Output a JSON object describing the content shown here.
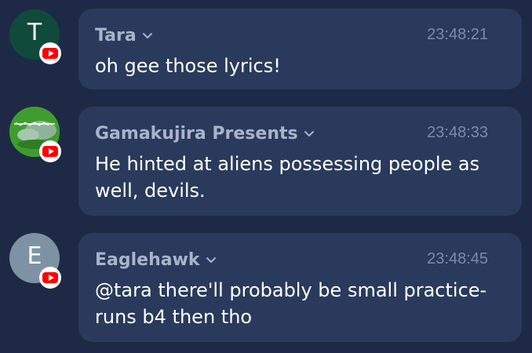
{
  "messages": [
    {
      "author": "Tara",
      "time": "23:48:21",
      "text": "oh gee those lyrics!",
      "avatar_letter": "T",
      "avatar_color": "#0f4a3a"
    },
    {
      "author": "Gamakujira Presents",
      "time": "23:48:33",
      "text": "He hinted at aliens possessing people as well, devils.",
      "avatar_color": "#3a9a2a"
    },
    {
      "author": "Eaglehawk",
      "time": "23:48:45",
      "text": "@tara there'll probably be small practice-runs b4 then tho",
      "avatar_letter": "E",
      "avatar_color": "#7d93a4"
    }
  ],
  "colors": {
    "background": "#1e2a45",
    "bubble": "#2a3a5c",
    "author": "#a9b3c9",
    "timestamp": "#7e8aa5",
    "youtube_red": "#ff0000"
  },
  "icons": {
    "platform_badge": "youtube-icon",
    "author_menu": "chevron-down-icon"
  }
}
